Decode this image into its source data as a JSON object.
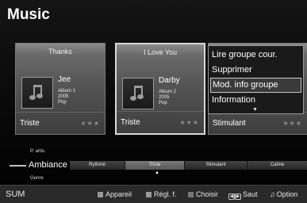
{
  "screen": {
    "title": "Music"
  },
  "cards": [
    {
      "song": "Thanks",
      "artist": "Jee",
      "album": "Album 1",
      "year": "2005",
      "genre": "Pop",
      "mood": "Triste",
      "stars": "★★★"
    },
    {
      "song": "I Love You",
      "artist": "Darby",
      "album": "Album 2",
      "year": "2005",
      "genre": "Pop",
      "mood": "Triste",
      "stars": "★★★"
    },
    {
      "mood": "Stimulant",
      "stars": "★★★"
    }
  ],
  "context_menu": {
    "items": [
      "Lire groupe cour.",
      "Supprimer",
      "Mod. info groupe",
      "Information"
    ],
    "selected_index": 2,
    "more_arrow": "▼"
  },
  "category": {
    "prev": "P. artis.",
    "current": "Ambiance",
    "next": "Genre"
  },
  "mood_bar": {
    "segments": [
      "Rythmé",
      "Triste",
      "Stimulant",
      "Calme"
    ],
    "active": "Triste",
    "pointer": "▲"
  },
  "footer": {
    "title": "SUM",
    "device_label": "Appareil",
    "settings_label": "Régl. f.",
    "choose_label": "Choisir",
    "skip_label": "Saut",
    "option_label": "Option"
  }
}
